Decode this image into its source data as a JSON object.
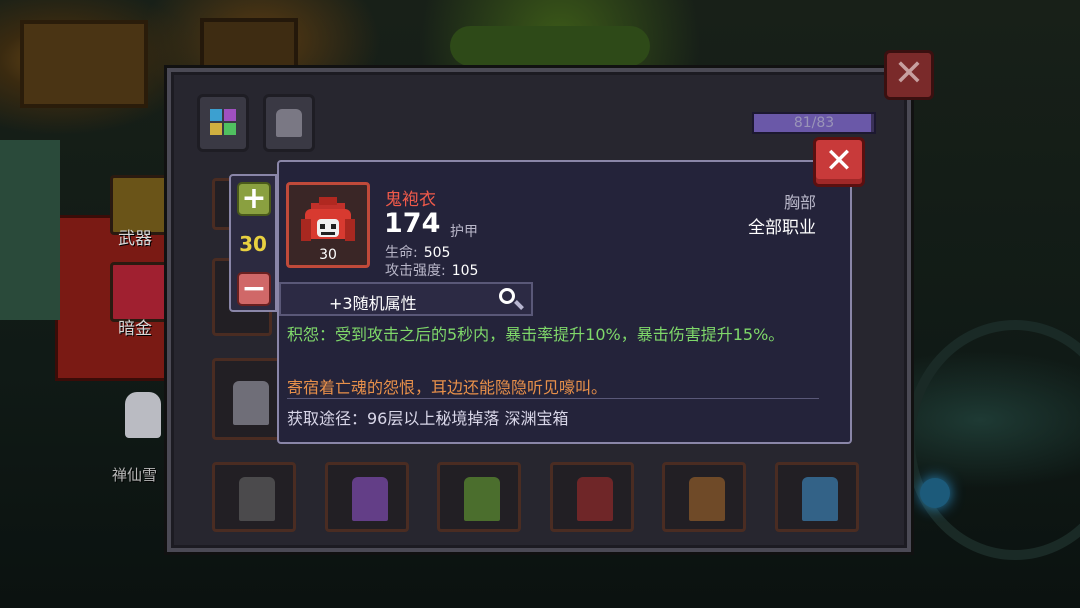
{
  "background": {
    "side_buttons": [
      {
        "label": "武器"
      },
      {
        "label": "暗金"
      }
    ],
    "character_label": "禅仙雪"
  },
  "panel": {
    "close_icon": "close-x-icon",
    "tabs": [
      {
        "icon": "grid-icon"
      },
      {
        "icon": "armor-icon"
      }
    ],
    "capacity": {
      "text": "81/83",
      "fill": 0.976
    }
  },
  "tooltip": {
    "close_icon": "close-x-icon",
    "quantity": "30",
    "plus_label": "+",
    "minus_label": "−",
    "item": {
      "name": "鬼袍衣",
      "count": "30",
      "main_value": "174",
      "main_unit": "护甲",
      "stats": [
        {
          "label": "生命:",
          "value": "505"
        },
        {
          "label": "攻击强度:",
          "value": "105"
        }
      ],
      "slot": "胸部",
      "class_restriction": "全部职业"
    },
    "random_attr": "+3随机属性",
    "effect_text": "积怨：受到攻击之后的5秒内，暴击率提升10%，暴击伤害提升15%。",
    "lore_text": "寄宿着亡魂的怨恨，耳边还能隐隐听见嚎叫。",
    "source_text": "获取途径：96层以上秘境掉落 深渊宝箱"
  },
  "colors": {
    "item_name": "#f05a4a",
    "effect": "#7fd86a",
    "lore": "#e8904a",
    "quantity": "#e8d040",
    "close_button": "#c83a3a"
  }
}
